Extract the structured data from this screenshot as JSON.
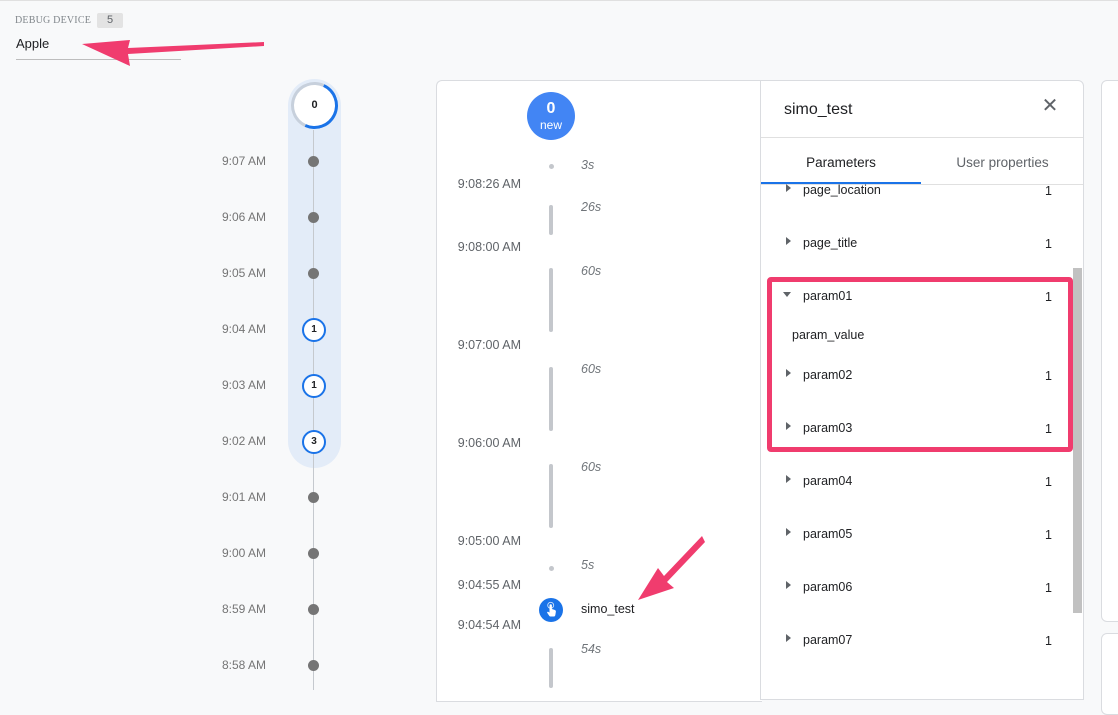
{
  "device": {
    "label": "DEBUG DEVICE",
    "count": "5",
    "value": "Apple"
  },
  "minutes": {
    "current_count": "0",
    "rows": [
      {
        "time": "9:07 AM",
        "count": null
      },
      {
        "time": "9:06 AM",
        "count": null
      },
      {
        "time": "9:05 AM",
        "count": null
      },
      {
        "time": "9:04 AM",
        "count": "1"
      },
      {
        "time": "9:03 AM",
        "count": "1"
      },
      {
        "time": "9:02 AM",
        "count": "3"
      },
      {
        "time": "9:01 AM",
        "count": null
      },
      {
        "time": "9:00 AM",
        "count": null
      },
      {
        "time": "8:59 AM",
        "count": null
      },
      {
        "time": "8:58 AM",
        "count": null
      }
    ]
  },
  "events": {
    "new_count": "0",
    "new_label": "new",
    "timestamps": [
      "9:08:26 AM",
      "9:08:00 AM",
      "9:07:00 AM",
      "9:06:00 AM",
      "9:05:00 AM",
      "9:04:55 AM",
      "9:04:54 AM"
    ],
    "durations": [
      "3s",
      "26s",
      "60s",
      "60s",
      "60s",
      "5s",
      "54s"
    ],
    "event_name": "simo_test"
  },
  "detail": {
    "title": "simo_test",
    "tabs": [
      "Parameters",
      "User properties"
    ],
    "active_tab": "Parameters",
    "params": [
      {
        "name": "page_location",
        "count": "1",
        "expanded": false
      },
      {
        "name": "page_title",
        "count": "1",
        "expanded": false
      },
      {
        "name": "param01",
        "count": "1",
        "expanded": true,
        "value": "param_value"
      },
      {
        "name": "param02",
        "count": "1",
        "expanded": false
      },
      {
        "name": "param03",
        "count": "1",
        "expanded": false
      },
      {
        "name": "param04",
        "count": "1",
        "expanded": false
      },
      {
        "name": "param05",
        "count": "1",
        "expanded": false
      },
      {
        "name": "param06",
        "count": "1",
        "expanded": false
      },
      {
        "name": "param07",
        "count": "1",
        "expanded": false
      }
    ]
  },
  "colors": {
    "accent": "#1a73e8",
    "highlight": "#f03c6e",
    "new_badge": "#4285f4"
  }
}
